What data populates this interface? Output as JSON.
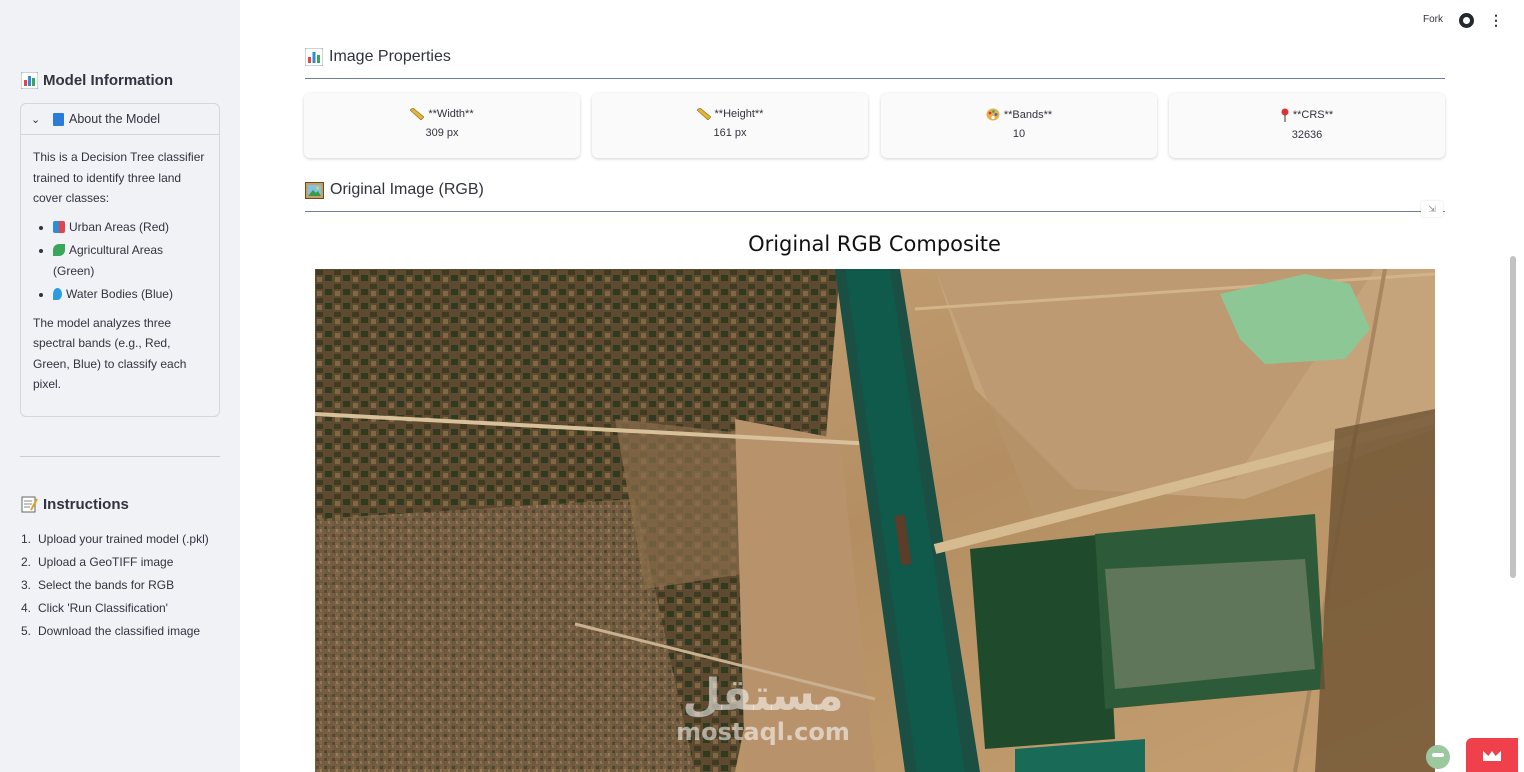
{
  "header": {
    "fork_label": "Fork",
    "github_icon": "github-icon",
    "menu_icon": "kebab-menu-icon"
  },
  "sidebar": {
    "model_info_title": "Model Information",
    "expander": {
      "label": "About the Model",
      "intro": "This is a Decision Tree classifier trained to identify three land cover classes:",
      "classes": [
        {
          "name": "Urban Areas",
          "suffix": "(Red)"
        },
        {
          "name": "Agricultural Areas",
          "suffix": "(Green)"
        },
        {
          "name": "Water Bodies",
          "suffix": "(Blue)"
        }
      ],
      "outro": "The model analyzes three spectral bands (e.g., Red, Green, Blue) to classify each pixel."
    },
    "instructions_title": "Instructions",
    "instructions": [
      "Upload your trained model (.pkl)",
      "Upload a GeoTIFF image",
      "Select the bands for RGB",
      "Click 'Run Classification'",
      "Download the classified image"
    ]
  },
  "main": {
    "properties_title": "Image Properties",
    "cards": [
      {
        "label": "**Width**",
        "value": "309 px",
        "icon": "ruler-icon"
      },
      {
        "label": "**Height**",
        "value": "161 px",
        "icon": "ruler-icon"
      },
      {
        "label": "**Bands**",
        "value": "10",
        "icon": "palette-icon"
      },
      {
        "label": "**CRS**",
        "value": "32636",
        "icon": "pin-icon"
      }
    ],
    "original_title": "Original Image (RGB)",
    "figure_title": "Original RGB Composite",
    "watermark_ar": "مستقل",
    "watermark_en": "mostaql.com"
  },
  "colors": {
    "sidebar_bg": "#f0f2f6",
    "divider": "#6b7fa6",
    "accent_red": "#f0404b"
  }
}
